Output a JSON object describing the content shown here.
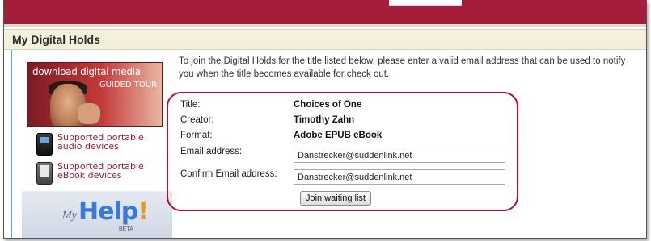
{
  "page": {
    "title": "My Digital Holds",
    "intro": "To join the Digital Holds for the title listed below, please enter a valid email address that can be used to notify you when the title becomes available for check out."
  },
  "sidebar": {
    "promo_line1": "download digital media",
    "promo_line2": "GUIDED TOUR",
    "devices": [
      {
        "label_line1": "Supported portable",
        "label_line2": "audio devices",
        "icon": "audio-player-icon"
      },
      {
        "label_line1": "Supported portable",
        "label_line2": "eBook devices",
        "icon": "ebook-reader-icon"
      }
    ],
    "help": {
      "my": "My",
      "help": "Help",
      "bang": "!",
      "beta": "BETA"
    }
  },
  "form": {
    "title_label": "Title:",
    "title_value": "Choices of One",
    "creator_label": "Creator:",
    "creator_value": "Timothy Zahn",
    "format_label": "Format:",
    "format_value": "Adobe EPUB eBook",
    "email_label": "Email address:",
    "email_value": "Danstrecker@suddenlink.net",
    "confirm_label": "Confirm Email address:",
    "confirm_value": "Danstrecker@suddenlink.net",
    "submit_label": "Join waiting list"
  },
  "colors": {
    "brand_red": "#a41e3a",
    "highlight_ring": "#b3102b",
    "link_red": "#9b1b2e"
  }
}
